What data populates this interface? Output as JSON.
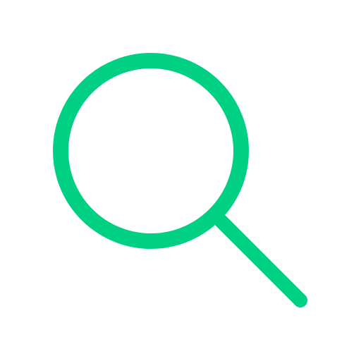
{
  "icon": {
    "name": "search-icon",
    "color": "#00d084",
    "background": "#ffffff"
  }
}
